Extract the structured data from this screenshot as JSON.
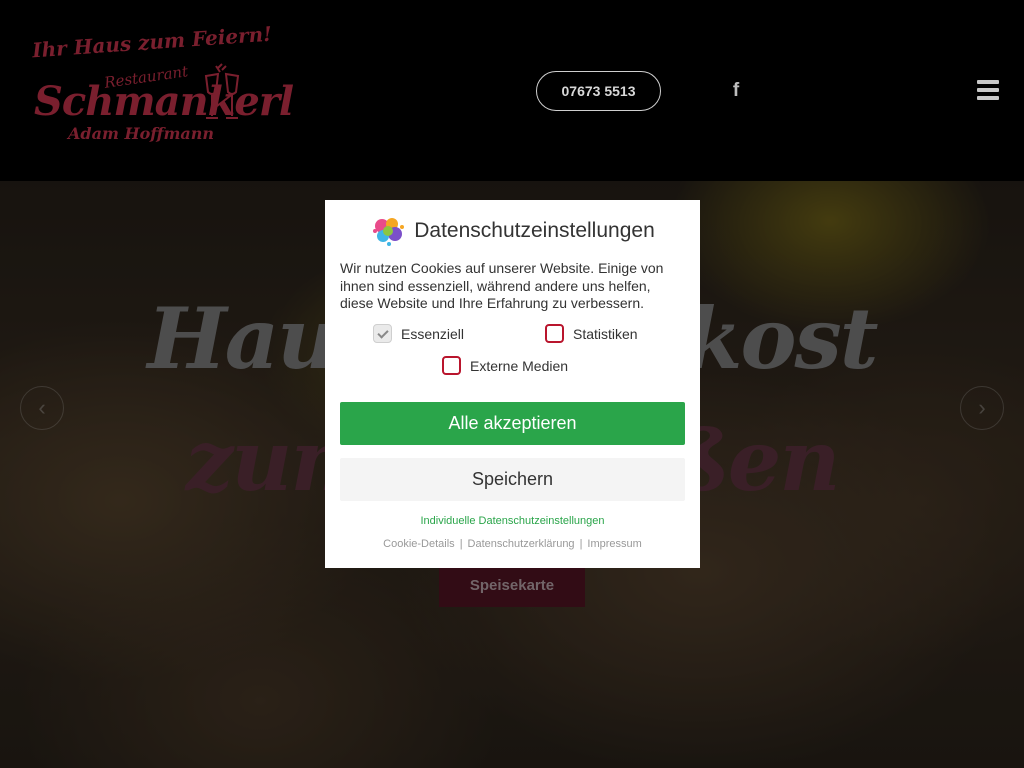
{
  "header": {
    "logo": {
      "line1": "Ihr Haus zum Feiern!",
      "line2": "Restaurant",
      "line3": "Schmankerl",
      "line4": "Adam Hoffmann"
    },
    "phone": "07673 5513",
    "facebook_icon": "f",
    "colors": {
      "logo": "#7a1f2e",
      "background": "#000000"
    }
  },
  "hero": {
    "title_line1": "Hausmannskost",
    "title_line2": "zum Genießen",
    "prev_arrow": "‹",
    "next_arrow": "›",
    "menu_button": "Speisekarte",
    "colors": {
      "button": "#5c1727"
    }
  },
  "cookie_modal": {
    "title": "Datenschutzeinstellungen",
    "description": "Wir nutzen Cookies auf unserer Website. Einige von ihnen sind essenziell, während andere uns helfen, diese Website und Ihre Erfahrung zu verbessern.",
    "options": [
      {
        "label": "Essenziell",
        "checked": true
      },
      {
        "label": "Statistiken",
        "checked": false
      },
      {
        "label": "Externe Medien",
        "checked": false
      }
    ],
    "accept_all": "Alle akzeptieren",
    "save": "Speichern",
    "individual_settings": "Individuelle Datenschutzeinstellungen",
    "footer_links": [
      "Cookie-Details",
      "Datenschutzerklärung",
      "Impressum"
    ],
    "colors": {
      "accept": "#2aa54a",
      "checkbox_border": "#b9152d"
    }
  }
}
